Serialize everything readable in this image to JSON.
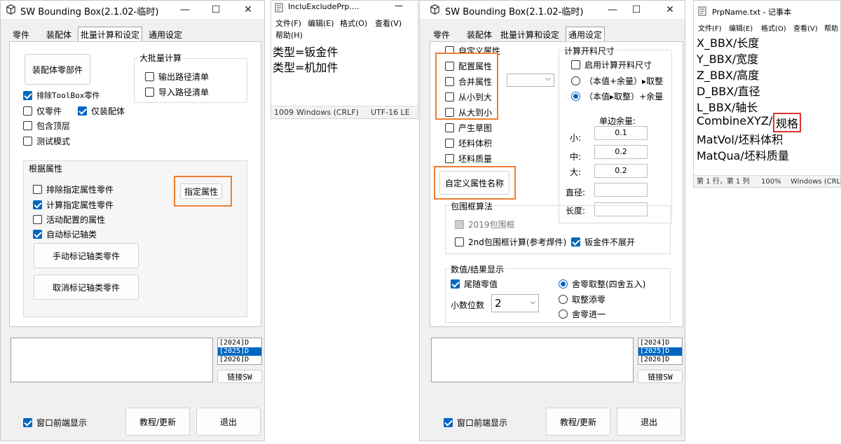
{
  "w1": {
    "title": "SW Bounding Box(2.1.02-临时)",
    "tabs": [
      "零件",
      "装配体",
      "批量计算和设定",
      "通用设定"
    ],
    "asm_parts_btn": "装配体零部件",
    "batch_group": "大批量计算",
    "output_path": "输出路径清单",
    "import_path": "导入路径清单",
    "exclude_toolbox": "排除ToolBox零件",
    "only_parts": "仅零件",
    "only_asm": "仅装配体",
    "include_top": "包含顶层",
    "test_mode": "测试模式",
    "prop_group": "根据属性",
    "exclude_prop": "排除指定属性零件",
    "calc_prop": "计算指定属性零件",
    "active_config": "活动配置的属性",
    "auto_mark": "自动标记轴类",
    "specify_prop_btn": "指定属性",
    "manual_mark_btn": "手动标记轴类零件",
    "cancel_mark_btn": "取消标记轴类零件",
    "versions": [
      "[2024]D",
      "[2025]D",
      "[2026]D"
    ],
    "link_btn": "链接SW",
    "topmost": "窗口前端显示",
    "tutorial_btn": "教程/更新",
    "exit_btn": "退出"
  },
  "np1": {
    "title": "IncluExcludePrp....",
    "menu": [
      "文件(F)",
      "编辑(E)",
      "格式(O)",
      "查看(V)",
      "帮助(H)"
    ],
    "lines": [
      "类型=钣金件",
      "类型=机加件"
    ],
    "status": [
      "1009",
      "Windows (CRLF)",
      "UTF-16 LE"
    ]
  },
  "w2": {
    "title": "SW Bounding Box(2.1.02-临时)",
    "tabs": [
      "零件",
      "装配体",
      "批量计算和设定",
      "通用设定"
    ],
    "custom_prop": "自定义属性",
    "config_prop": "配置属性",
    "merge_prop": "合并属性",
    "small_to_large": "从小到大",
    "large_to_small": "从大到小",
    "sketch": "产生草图",
    "blank_vol": "坯料体积",
    "blank_mass": "坯料质量",
    "custom_name_btn": "自定义属性名称",
    "size_group": "计算开料尺寸",
    "enable_size": "启用计算开料尺寸",
    "radio_a": "（本值+余量）▸取整",
    "radio_b": "（本值▸取整）+余量",
    "margin_label": "单边余量:",
    "small": "小:",
    "mid": "中:",
    "large": "大:",
    "small_val": "0.1",
    "mid_val": "0.2",
    "large_val": "0.2",
    "diameter": "直径:",
    "length": "长度:",
    "bbox_group": "包围框算法",
    "bbox2019": "2019包围框",
    "bbox2nd": "2nd包围框计算(参考焊件)",
    "no_unfold": "钣金件不展开",
    "result_group": "数值/结果显示",
    "trailing_zero": "尾随零值",
    "decimals_label": "小数位数",
    "decimals_val": "2",
    "round_a": "舍零取整(四舍五入)",
    "round_b": "取整添零",
    "round_c": "舍零进一",
    "versions": [
      "[2024]D",
      "[2025]D",
      "[2026]D"
    ],
    "link_btn": "链接SW",
    "topmost": "窗口前端显示",
    "tutorial_btn": "教程/更新",
    "exit_btn": "退出"
  },
  "np2": {
    "title": "PrpName.txt - 记事本",
    "menu": [
      "文件(F)",
      "编辑(E)",
      "格式(O)",
      "查看(V)",
      "帮助"
    ],
    "lines": [
      "X_BBX/长度",
      "Y_BBX/宽度",
      "Z_BBX/高度",
      "D_BBX/直径",
      "L_BBX/轴长",
      "CombineXYZ/",
      "规格",
      "MatVol/坯料体积",
      "MatQua/坯料质量"
    ],
    "status": [
      "第 1 行，第 1 列",
      "100%",
      "Windows (CRL"
    ]
  },
  "accent": "#ef7d31",
  "check_color": "#0067c0"
}
